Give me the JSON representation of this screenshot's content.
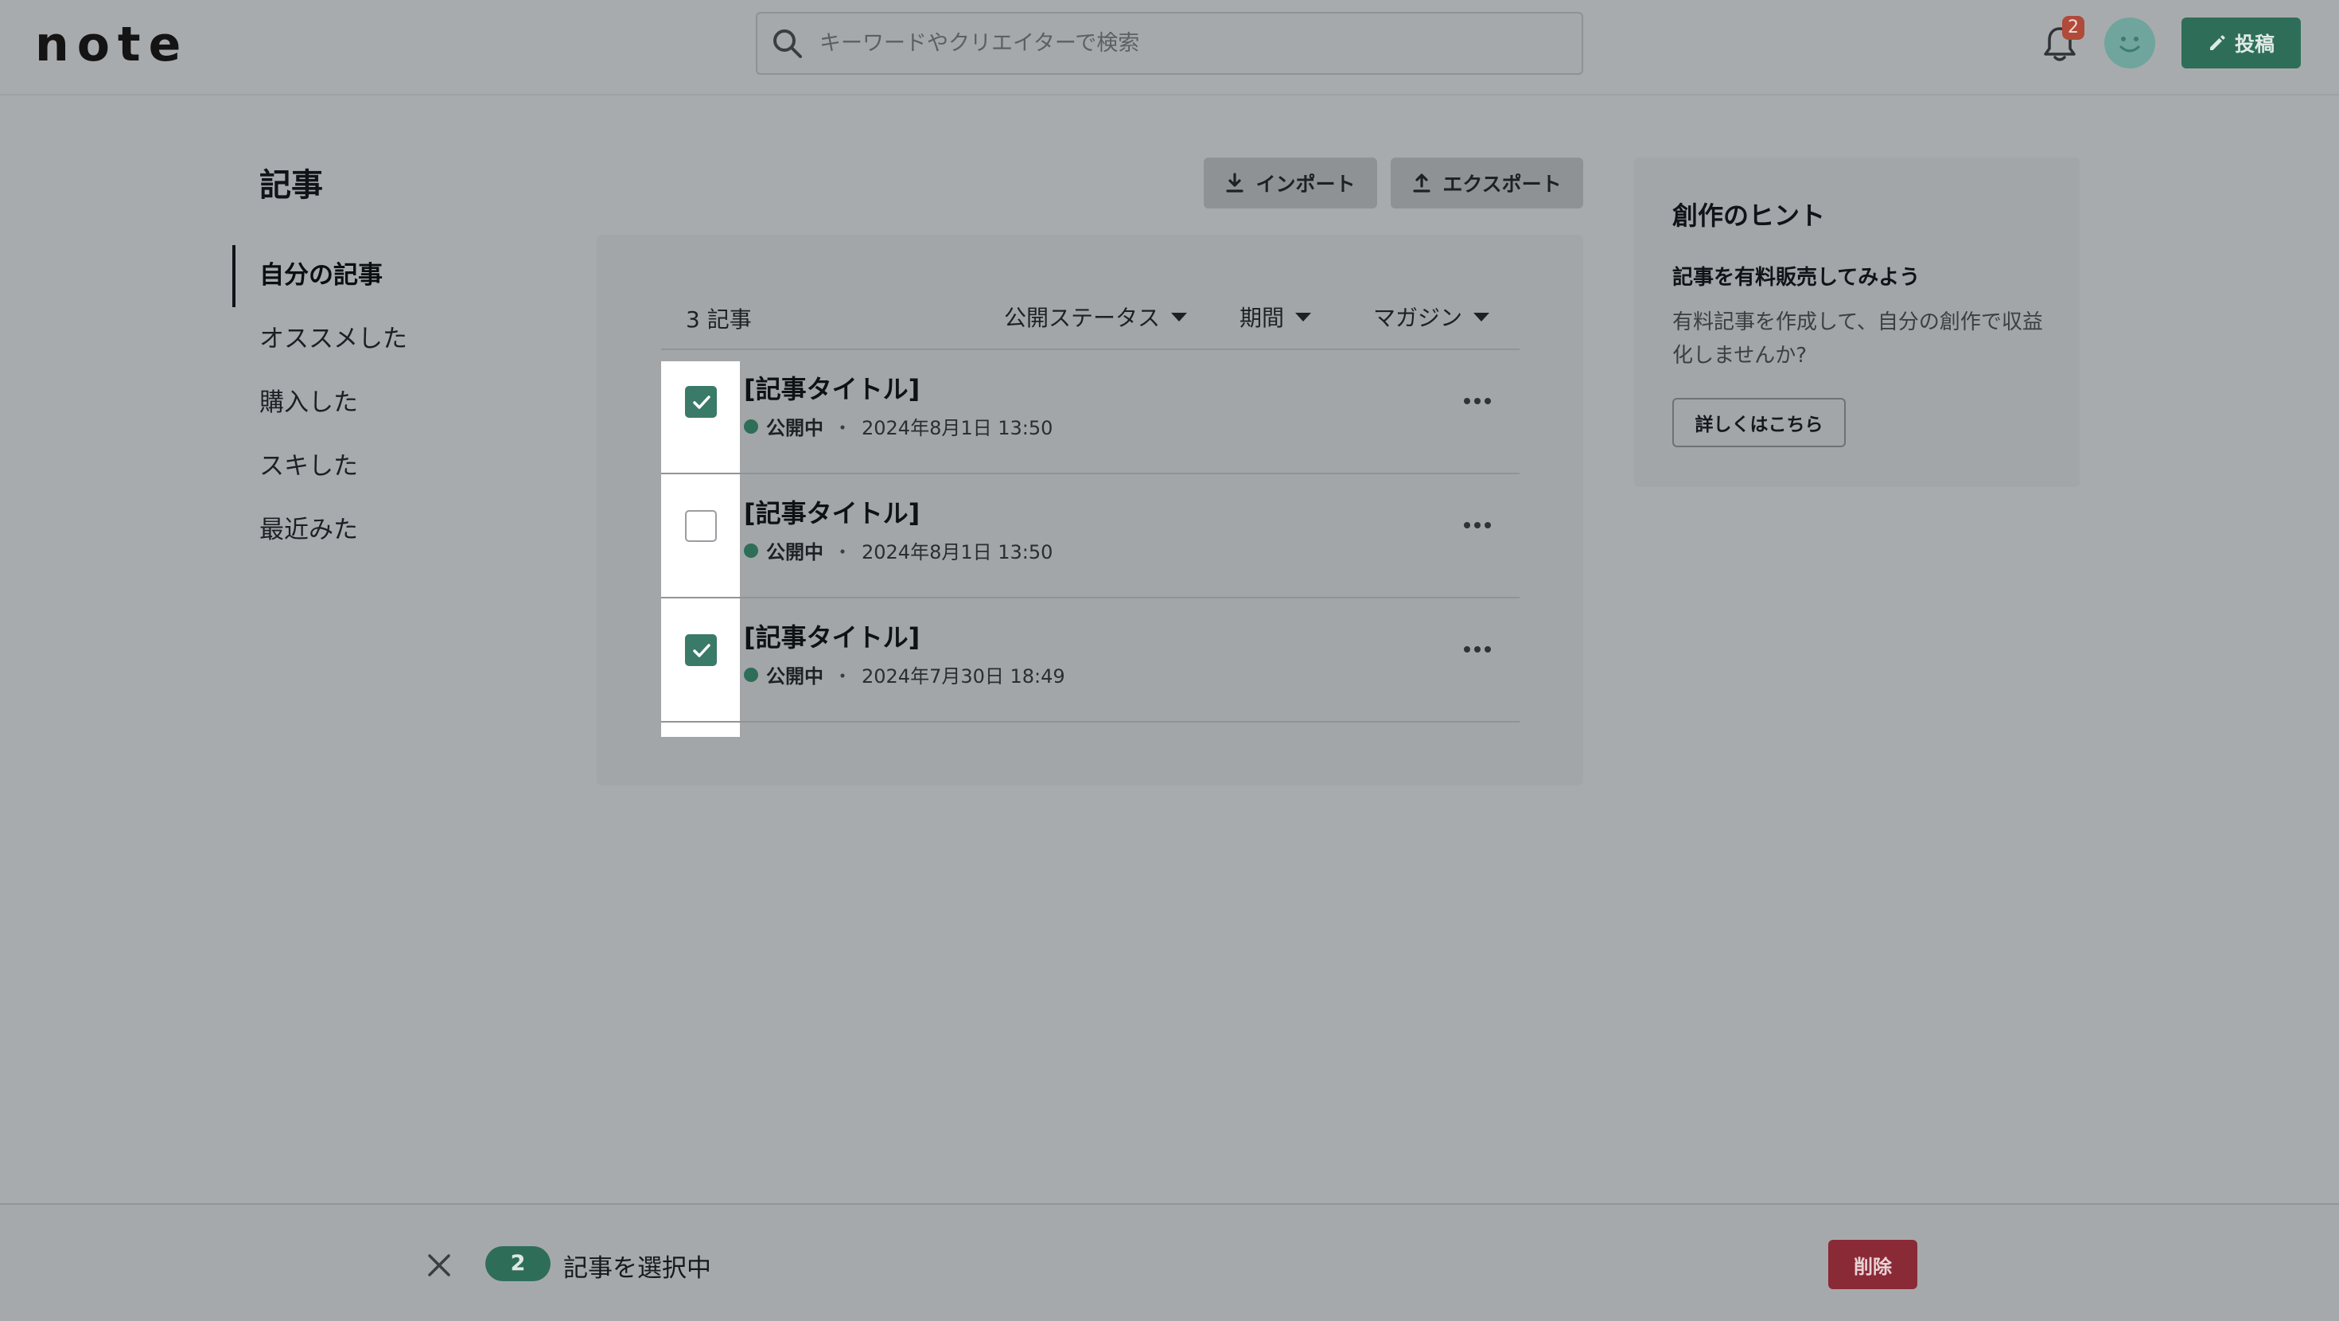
{
  "header": {
    "logo": "note",
    "search_placeholder": "キーワードやクリエイターで検索",
    "notification_count": "2",
    "post_label": "投稿"
  },
  "sidebar": {
    "title": "記事",
    "items": [
      {
        "label": "自分の記事",
        "active": true
      },
      {
        "label": "オススメした",
        "active": false
      },
      {
        "label": "購入した",
        "active": false
      },
      {
        "label": "スキした",
        "active": false
      },
      {
        "label": "最近みた",
        "active": false
      }
    ]
  },
  "toolbar": {
    "import_label": "インポート",
    "export_label": "エクスポート"
  },
  "list": {
    "count_label": "3 記事",
    "filters": [
      "公開ステータス",
      "期間",
      "マガジン"
    ],
    "rows": [
      {
        "title": "[記事タイトル]",
        "status": "公開中",
        "date": "2024年8月1日 13:50",
        "checked": true
      },
      {
        "title": "[記事タイトル]",
        "status": "公開中",
        "date": "2024年8月1日 13:50",
        "checked": false
      },
      {
        "title": "[記事タイトル]",
        "status": "公開中",
        "date": "2024年7月30日 18:49",
        "checked": true
      }
    ]
  },
  "hint": {
    "heading": "創作のヒント",
    "subheading": "記事を有料販売してみよう",
    "body": "有料記事を作成して、自分の創作で収益化しませんか?",
    "button_label": "詳しくはこちら"
  },
  "selection_bar": {
    "count": "2",
    "label": "記事を選択中",
    "delete_label": "削除"
  },
  "colors": {
    "accent": "#2e6e58",
    "danger": "#8a2a36",
    "badge": "#b04a3a"
  }
}
